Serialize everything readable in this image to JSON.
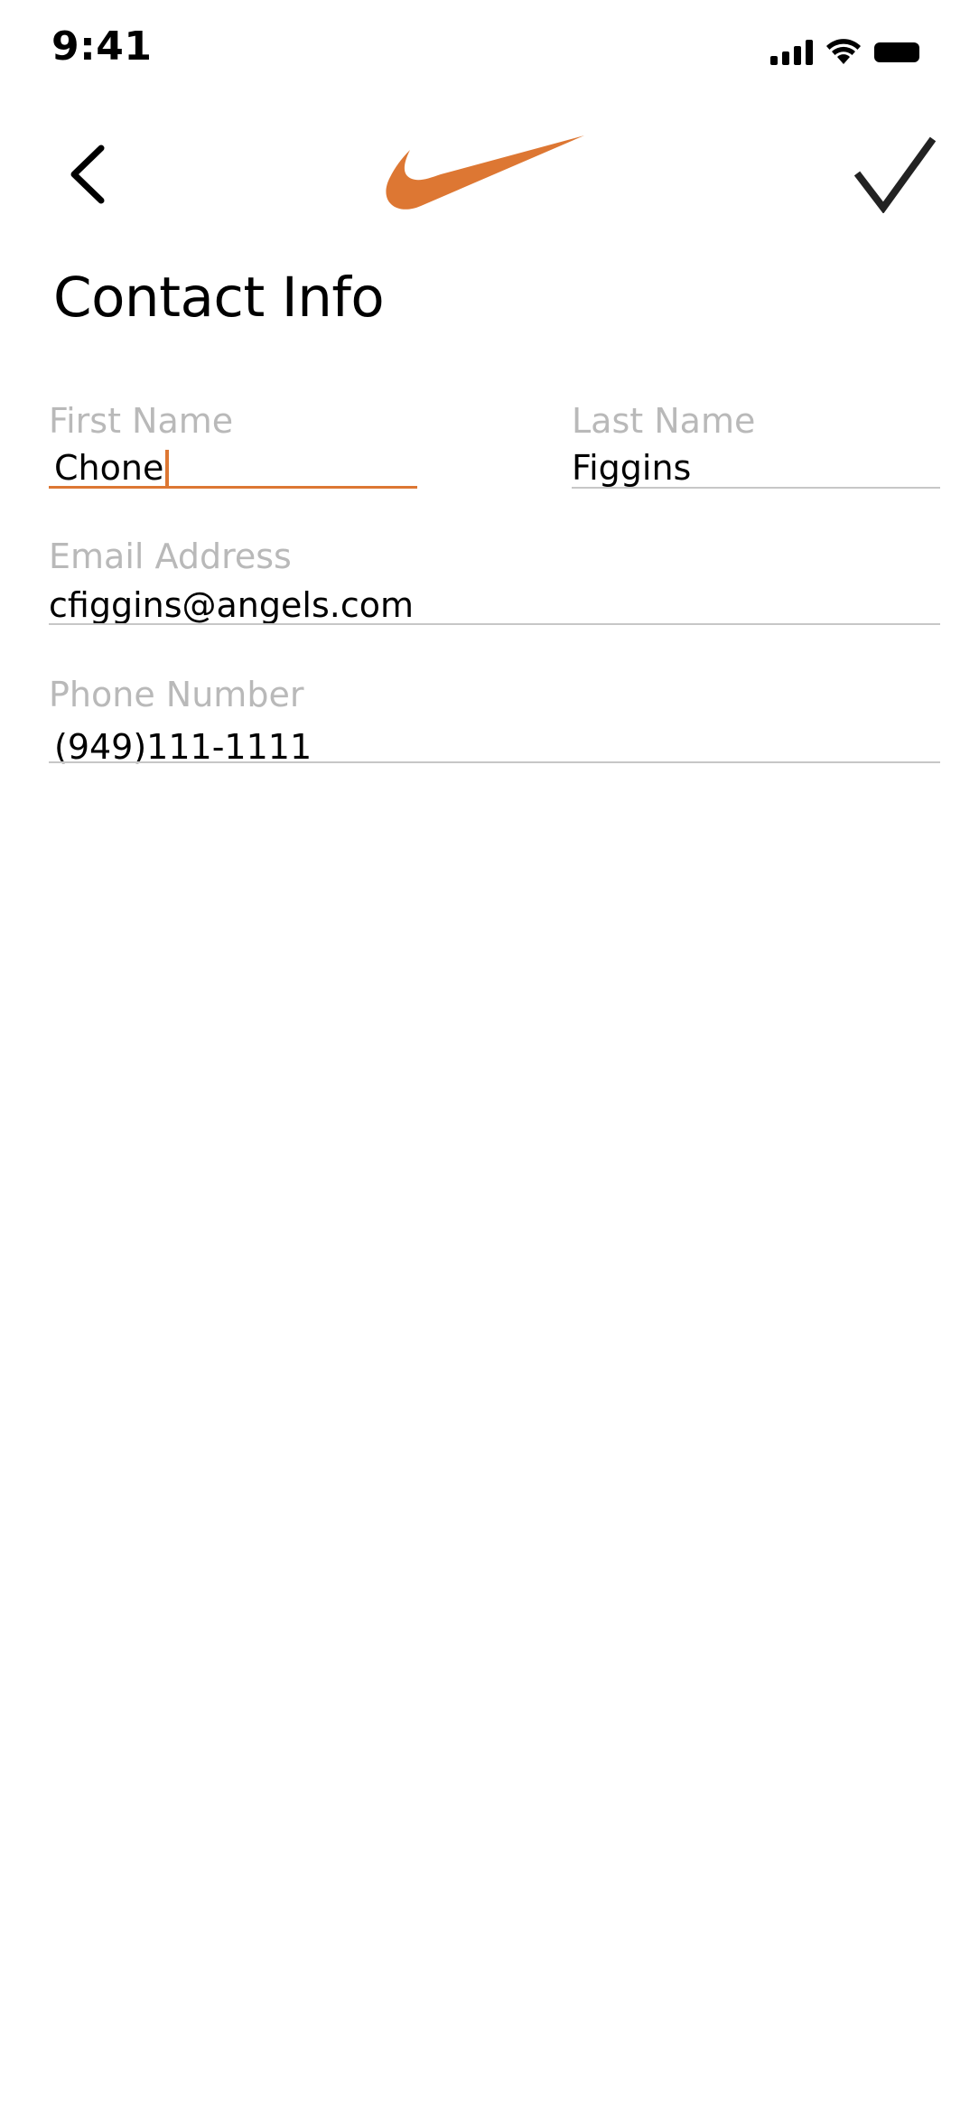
{
  "status_bar": {
    "time": "9:41",
    "icons": [
      "cellular-signal-icon",
      "wifi-icon",
      "battery-icon"
    ]
  },
  "nav": {
    "back_icon": "chevron-left-icon",
    "logo": "swoosh-logo",
    "confirm_icon": "checkmark-icon"
  },
  "page": {
    "title": "Contact Info"
  },
  "form": {
    "first_name": {
      "label": "First Name",
      "value": "Chone"
    },
    "last_name": {
      "label": "Last  Name",
      "value": "Figgins"
    },
    "email": {
      "label": "Email Address",
      "value": "cfiggins@angels.com"
    },
    "phone": {
      "label": "Phone Number",
      "value": "(949)111-1111"
    }
  },
  "colors": {
    "accent": "#DD7733",
    "label_gray": "#B9B9B9",
    "underline_gray": "#C7C7C7",
    "text": "#000000",
    "background": "#FFFFFF"
  }
}
